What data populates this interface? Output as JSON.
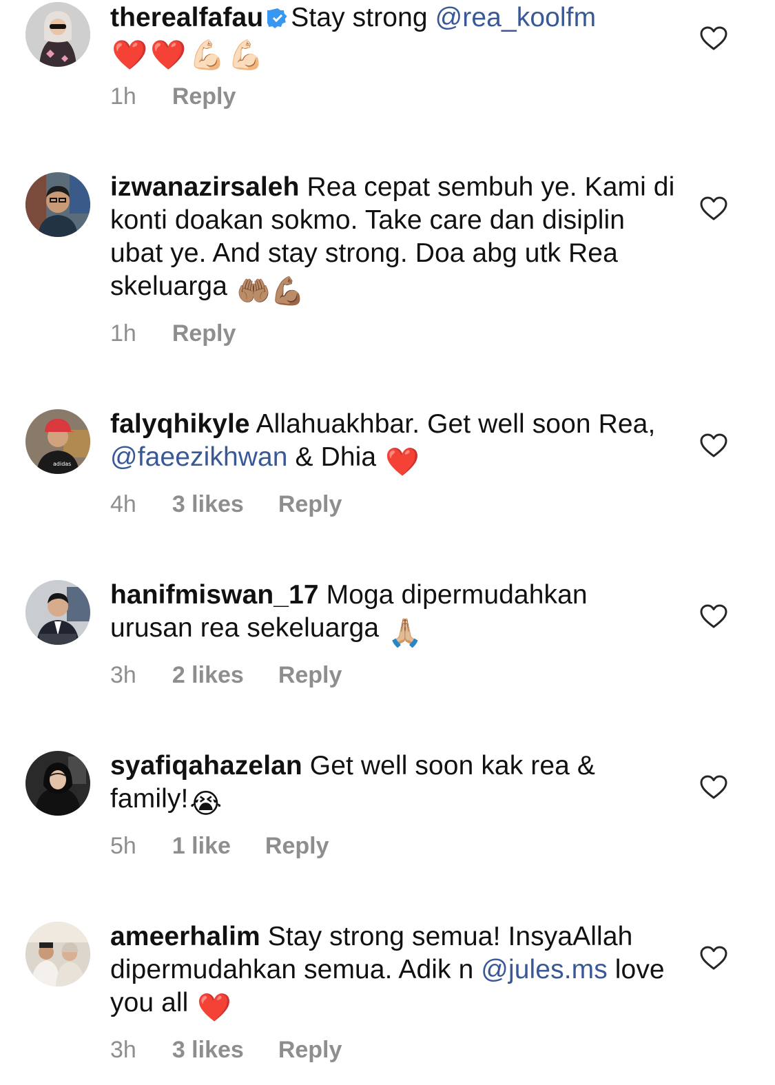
{
  "comments": [
    {
      "username": "therealfafau",
      "verified": true,
      "text_before": "Stay strong ",
      "mention": "@rea_koolfm",
      "text_after": "",
      "line2_emojis": "❤️❤️💪🏻💪🏻",
      "time": "1h",
      "likes": "",
      "reply": "Reply",
      "avatar_icon": "avatar-hijab-sunglasses"
    },
    {
      "username": "izwanazirsaleh",
      "text": "Rea cepat sembuh ye. Kami di konti doakan sokmo. Take care dan disiplin ubat ye. And stay strong. Doa abg utk Rea skeluarga",
      "emojis": "🤲🏽💪🏽",
      "time": "1h",
      "likes": "",
      "reply": "Reply",
      "avatar_icon": "avatar-man-glasses"
    },
    {
      "username": "falyqhikyle",
      "text_before": "Allahuakhbar. Get well soon Rea, ",
      "mention": "@faeezikhwan",
      "text_after": " & Dhia",
      "emojis": "❤️",
      "time": "4h",
      "likes": "3 likes",
      "reply": "Reply",
      "avatar_icon": "avatar-man-cap"
    },
    {
      "username": "hanifmiswan_17",
      "text": "Moga dipermudahkan urusan rea sekeluarga",
      "emojis": "🙏🏼",
      "time": "3h",
      "likes": "2 likes",
      "reply": "Reply",
      "avatar_icon": "avatar-man-suit"
    },
    {
      "username": "syafiqahazelan",
      "text": "Get well soon kak rea & family!",
      "emojis": "😭",
      "time": "5h",
      "likes": "1 like",
      "reply": "Reply",
      "avatar_icon": "avatar-woman-hijab"
    },
    {
      "username": "ameerhalim",
      "text_before": "Stay strong semua! InsyaAllah dipermudahkan semua. Adik n ",
      "mention": "@jules.ms",
      "text_after": " love you all",
      "emojis": "❤️",
      "time": "3h",
      "likes": "3 likes",
      "reply": "Reply",
      "avatar_icon": "avatar-couple"
    }
  ],
  "colors": {
    "text": "#111111",
    "meta": "#8e8e8e",
    "mention": "#385898",
    "verified": "#3897f0",
    "heart": "#e0202b"
  },
  "icons": {
    "like": "heart-outline-icon",
    "verified": "verified-badge-icon"
  }
}
